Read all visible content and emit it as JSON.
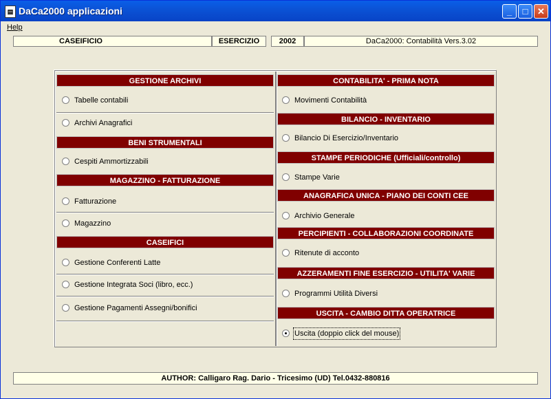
{
  "window": {
    "title": "DaCa2000 applicazioni",
    "minimize_label": "_",
    "maximize_label": "□",
    "close_label": "✕"
  },
  "menu": {
    "help_label": "Help"
  },
  "info": {
    "company": "CASEIFICIO",
    "year_label": "ESERCIZIO",
    "year": "2002",
    "version": "DaCa2000: Contabilità Vers.3.02"
  },
  "left": {
    "archivi": {
      "header": "GESTIONE ARCHIVI",
      "items": [
        "Tabelle contabili",
        "Archivi Anagrafici"
      ]
    },
    "beni": {
      "header": "BENI STRUMENTALI",
      "items": [
        "Cespiti Ammortizzabili"
      ]
    },
    "magazzino": {
      "header": "MAGAZZINO - FATTURAZIONE",
      "items": [
        "Fatturazione",
        "Magazzino"
      ]
    },
    "caseifici": {
      "header": "CASEIFICI",
      "items": [
        "Gestione Conferenti Latte",
        "Gestione Integrata Soci (libro, ecc.)",
        "Gestione Pagamenti  Assegni/bonifici"
      ]
    }
  },
  "right": {
    "contabilita": {
      "header": "CONTABILITA' - PRIMA NOTA",
      "items": [
        "Movimenti Contabilità"
      ]
    },
    "bilancio": {
      "header": "BILANCIO - INVENTARIO",
      "items": [
        "Bilancio Di Esercizio/Inventario"
      ]
    },
    "stampe": {
      "header": "STAMPE PERIODICHE (Ufficiali/controllo)",
      "items": [
        "Stampe Varie"
      ]
    },
    "anagrafica": {
      "header": "ANAGRAFICA UNICA - PIANO DEI CONTI CEE",
      "items": [
        "Archivio Generale"
      ]
    },
    "percipienti": {
      "header": "PERCIPIENTI - COLLABORAZIONI COORDINATE",
      "items": [
        "Ritenute di acconto"
      ]
    },
    "azzeramenti": {
      "header": "AZZERAMENTI FINE ESERCIZIO - UTILITA' VARIE",
      "items": [
        "Programmi Utilità Diversi"
      ]
    },
    "uscita": {
      "header": "USCITA - CAMBIO DITTA OPERATRICE",
      "items": [
        "Uscita  (doppio click del mouse)"
      ]
    }
  },
  "footer": {
    "text": "AUTHOR: Calligaro Rag. Dario - Tricesimo (UD) Tel.0432-880816"
  },
  "colors": {
    "header_bg": "#800000",
    "title_bg": "#0b53d6",
    "field_bg": "#ffffe8"
  }
}
